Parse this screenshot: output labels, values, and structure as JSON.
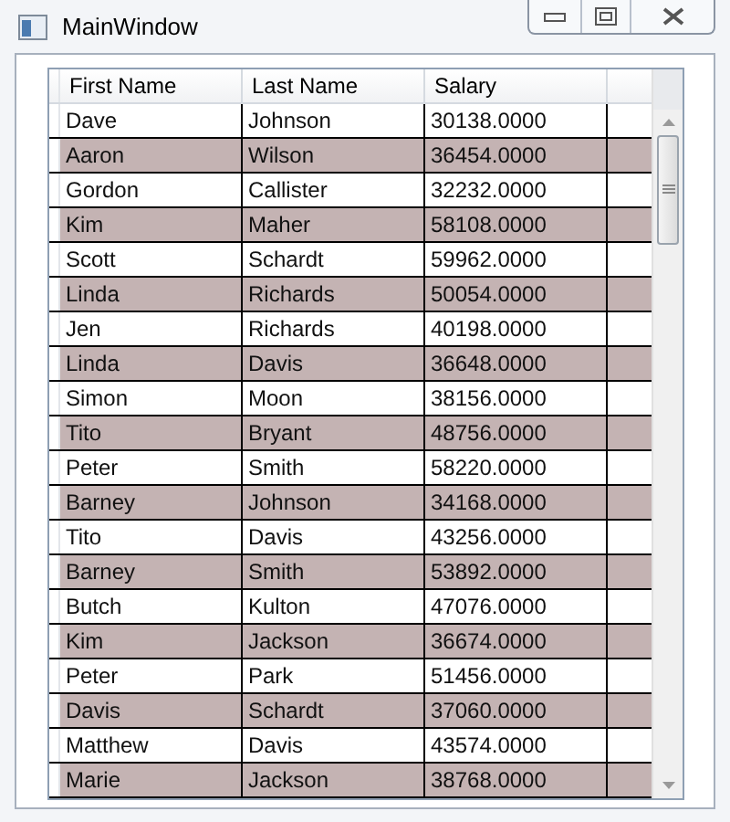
{
  "window": {
    "title": "MainWindow"
  },
  "table": {
    "columns": [
      "First Name",
      "Last Name",
      "Salary"
    ],
    "rows": [
      {
        "cells": [
          "Dave",
          "Johnson",
          "30138.0000"
        ],
        "alternate": false
      },
      {
        "cells": [
          "Aaron",
          "Wilson",
          "36454.0000"
        ],
        "alternate": true
      },
      {
        "cells": [
          "Gordon",
          "Callister",
          "32232.0000"
        ],
        "alternate": false
      },
      {
        "cells": [
          "Kim",
          "Maher",
          "58108.0000"
        ],
        "alternate": true
      },
      {
        "cells": [
          "Scott",
          "Schardt",
          "59962.0000"
        ],
        "alternate": false
      },
      {
        "cells": [
          "Linda",
          "Richards",
          "50054.0000"
        ],
        "alternate": true
      },
      {
        "cells": [
          "Jen",
          "Richards",
          "40198.0000"
        ],
        "alternate": false
      },
      {
        "cells": [
          "Linda",
          "Davis",
          "36648.0000"
        ],
        "alternate": true
      },
      {
        "cells": [
          "Simon",
          "Moon",
          "38156.0000"
        ],
        "alternate": false
      },
      {
        "cells": [
          "Tito",
          "Bryant",
          "48756.0000"
        ],
        "alternate": true
      },
      {
        "cells": [
          "Peter",
          "Smith",
          "58220.0000"
        ],
        "alternate": false
      },
      {
        "cells": [
          "Barney",
          "Johnson",
          "34168.0000"
        ],
        "alternate": true
      },
      {
        "cells": [
          "Tito",
          "Davis",
          "43256.0000"
        ],
        "alternate": false
      },
      {
        "cells": [
          "Barney",
          "Smith",
          "53892.0000"
        ],
        "alternate": true
      },
      {
        "cells": [
          "Butch",
          "Kulton",
          "47076.0000"
        ],
        "alternate": false
      },
      {
        "cells": [
          "Kim",
          "Jackson",
          "36674.0000"
        ],
        "alternate": true
      },
      {
        "cells": [
          "Peter",
          "Park",
          "51456.0000"
        ],
        "alternate": false
      },
      {
        "cells": [
          "Davis",
          "Schardt",
          "37060.0000"
        ],
        "alternate": true
      },
      {
        "cells": [
          "Matthew",
          "Davis",
          "43574.0000"
        ],
        "alternate": false
      },
      {
        "cells": [
          "Marie",
          "Jackson",
          "38768.0000"
        ],
        "alternate": true
      }
    ]
  }
}
